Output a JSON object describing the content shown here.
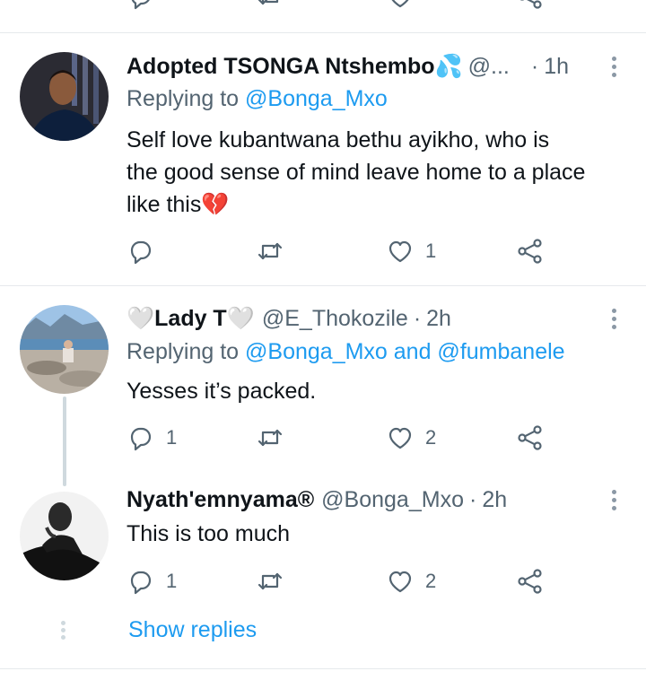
{
  "tweets": [
    {
      "name": "Adopted TSONGA Ntshembo",
      "name_emoji": "💦",
      "handle": "@...",
      "time": "1h",
      "reply_prefix": "Replying to",
      "reply_mentions": "@Bonga_Mxo",
      "body_lines": [
        "Self love kubantwana bethu ayikho, who is",
        "the good sense of mind leave home to a place",
        "like this"
      ],
      "body_emoji": "💔",
      "reply_count": "",
      "like_count": "1"
    },
    {
      "name_prefix_emoji": "🤍",
      "name": "Lady T",
      "name_emoji": "🤍",
      "handle": "@E_Thokozile",
      "time": "2h",
      "reply_prefix": "Replying to",
      "reply_mentions": "@Bonga_Mxo and @fumbanele",
      "body_lines": [
        "Yesses it’s packed."
      ],
      "reply_count": "1",
      "like_count": "2"
    },
    {
      "name": "Nyath'emnyama®",
      "handle": "@Bonga_Mxo",
      "time": "2h",
      "body_lines": [
        "This is too much"
      ],
      "reply_count": "1",
      "like_count": "2"
    }
  ],
  "separator": "·",
  "show_replies_label": "Show replies",
  "colors": {
    "accent": "#1d9bf0",
    "secondary_text": "#536471",
    "divider": "#e6e9ec"
  },
  "icons": [
    "reply-icon",
    "retweet-icon",
    "like-icon",
    "share-icon",
    "more-icon"
  ]
}
